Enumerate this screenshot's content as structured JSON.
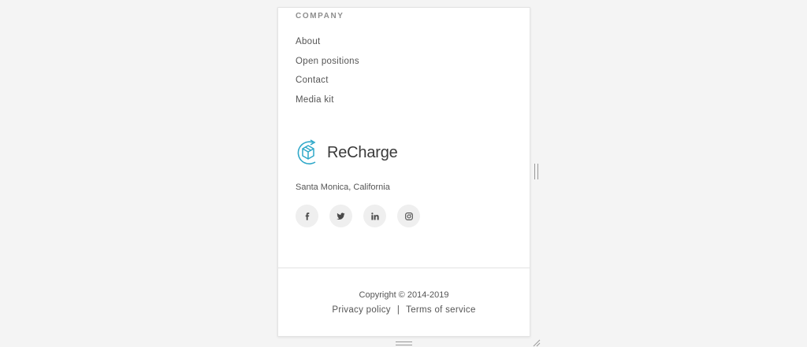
{
  "company": {
    "heading": "COMPANY",
    "links": [
      {
        "label": "About"
      },
      {
        "label": "Open positions"
      },
      {
        "label": "Contact"
      },
      {
        "label": "Media kit"
      }
    ]
  },
  "brand": {
    "name": "ReCharge",
    "logo_icon": "recharge-box-icon",
    "accent_color": "#2fa8c9",
    "location": "Santa Monica, California"
  },
  "social": [
    {
      "name": "facebook",
      "icon": "facebook-icon"
    },
    {
      "name": "twitter",
      "icon": "twitter-icon"
    },
    {
      "name": "linkedin",
      "icon": "linkedin-icon"
    },
    {
      "name": "instagram",
      "icon": "instagram-icon"
    }
  ],
  "footer": {
    "copyright": "Copyright © 2014-2019",
    "privacy_label": "Privacy policy",
    "separator": "|",
    "terms_label": "Terms of service"
  }
}
